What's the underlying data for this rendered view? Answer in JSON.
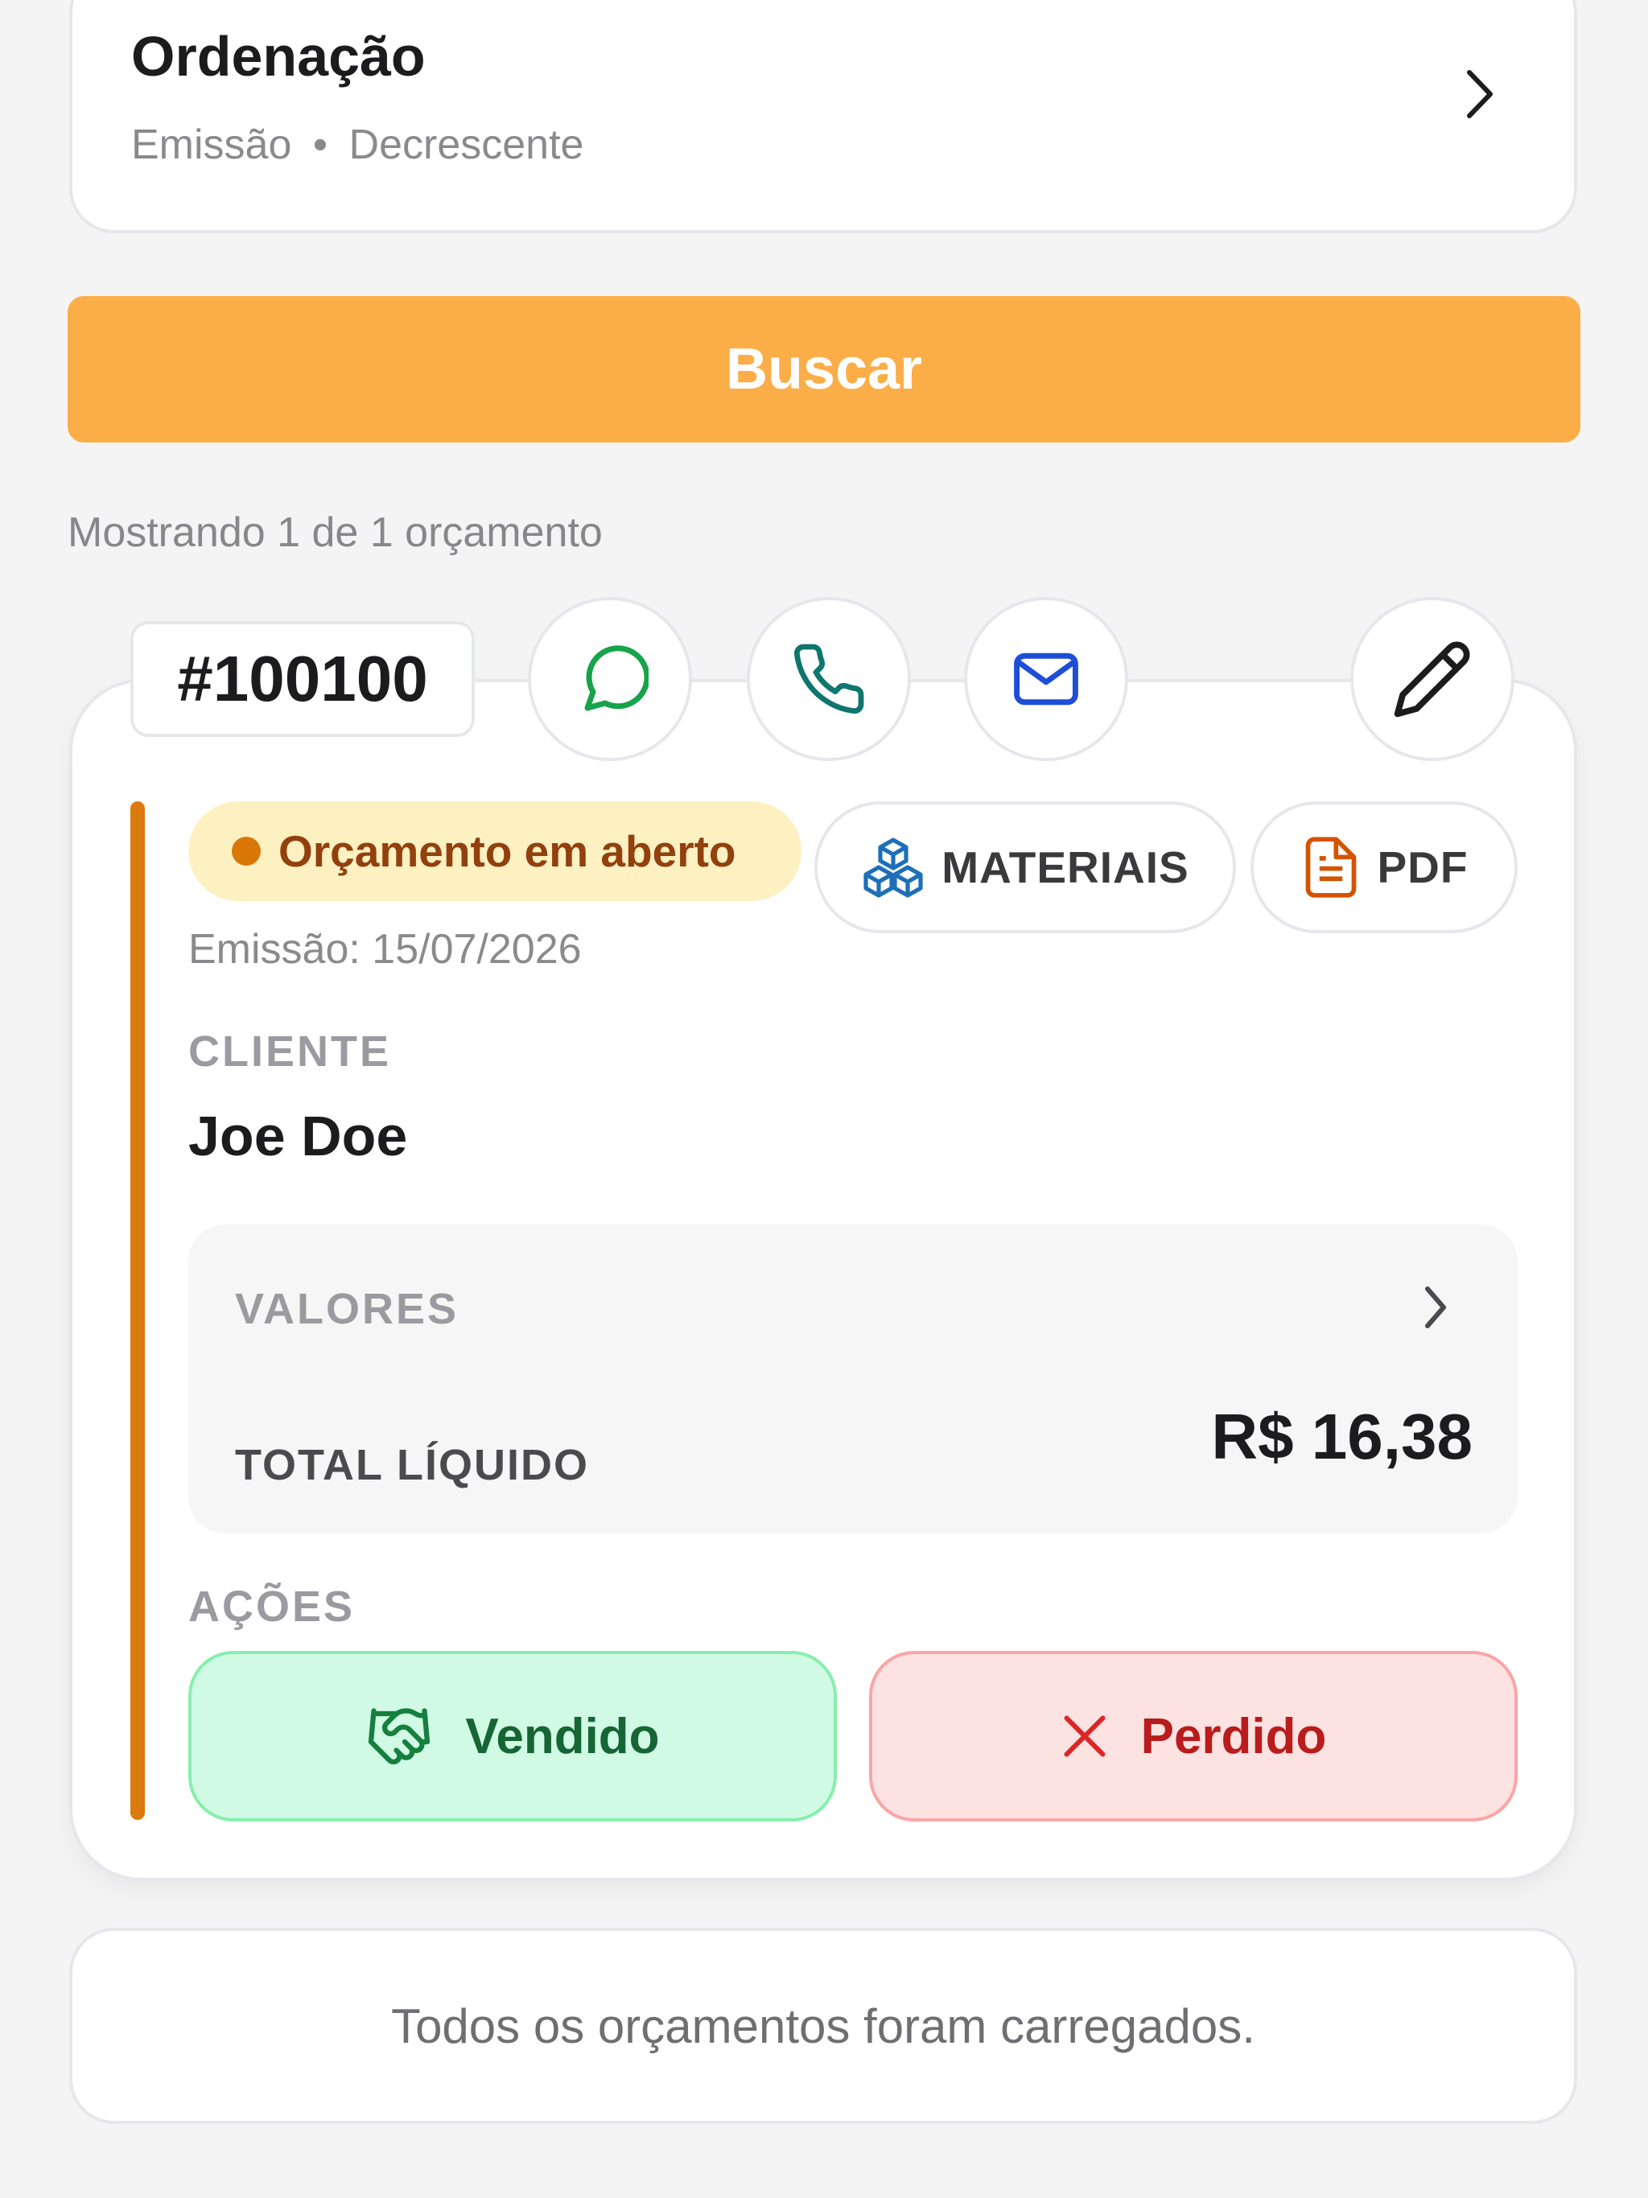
{
  "sorting": {
    "title": "Ordenação",
    "field": "Emissão",
    "separator": "•",
    "direction": "Decrescente"
  },
  "search": {
    "label": "Buscar",
    "color": "#fbad47"
  },
  "results": {
    "count_text": "Mostrando 1 de 1 orçamento"
  },
  "quote": {
    "id": "#100100",
    "contact_icons": [
      "whatsapp-icon",
      "phone-icon",
      "mail-icon"
    ],
    "edit_icon": "pencil-icon",
    "status": {
      "text": "Orçamento em aberto",
      "color": "#d97706"
    },
    "materials_label": "MATERIAIS",
    "pdf_label": "PDF",
    "emission": "Emissão: 15/07/2026",
    "client_label": "CLIENTE",
    "client_name": "Joe Doe",
    "values": {
      "label": "VALORES",
      "total_label": "TOTAL LÍQUIDO",
      "total_value": "R$ 16,38"
    },
    "actions": {
      "label": "AÇÕES",
      "sold_label": "Vendido",
      "lost_label": "Perdido"
    }
  },
  "footer": {
    "text": "Todos os orçamentos foram carregados."
  }
}
